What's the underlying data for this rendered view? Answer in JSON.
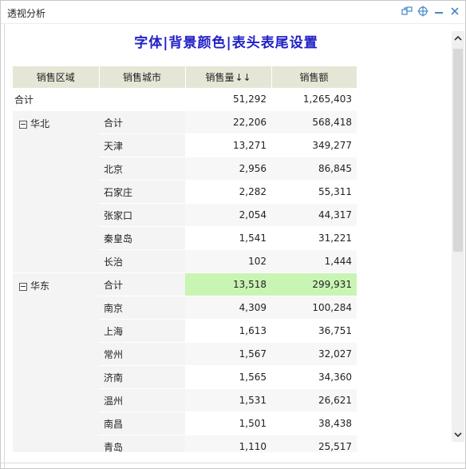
{
  "window": {
    "title": "透视分析"
  },
  "toolbar_icons": [
    "share-icon",
    "target-icon",
    "minimize-icon",
    "close-icon"
  ],
  "report": {
    "title_parts": [
      "字体",
      "背景颜色",
      "表头表尾设置"
    ],
    "separator": "|"
  },
  "table": {
    "headers": [
      "销售区域",
      "销售城市",
      "销售量",
      "销售额"
    ],
    "sort_indicator": "↓↓",
    "grand_total": {
      "label": "合计",
      "qty": "51,292",
      "amount": "1,265,403"
    },
    "groups": [
      {
        "region": "华北",
        "rows": [
          {
            "city": "合计",
            "qty": "22,206",
            "amount": "568,418"
          },
          {
            "city": "天津",
            "qty": "13,271",
            "amount": "349,277"
          },
          {
            "city": "北京",
            "qty": "2,956",
            "amount": "86,845"
          },
          {
            "city": "石家庄",
            "qty": "2,282",
            "amount": "55,311"
          },
          {
            "city": "张家口",
            "qty": "2,054",
            "amount": "44,317"
          },
          {
            "city": "秦皇岛",
            "qty": "1,541",
            "amount": "31,221"
          },
          {
            "city": "长治",
            "qty": "102",
            "amount": "1,444"
          }
        ]
      },
      {
        "region": "华东",
        "rows": [
          {
            "city": "合计",
            "qty": "13,518",
            "amount": "299,931",
            "highlight": true
          },
          {
            "city": "南京",
            "qty": "4,309",
            "amount": "100,284"
          },
          {
            "city": "上海",
            "qty": "1,613",
            "amount": "36,751"
          },
          {
            "city": "常州",
            "qty": "1,567",
            "amount": "32,027"
          },
          {
            "city": "济南",
            "qty": "1,565",
            "amount": "34,360"
          },
          {
            "city": "温州",
            "qty": "1,531",
            "amount": "26,621"
          },
          {
            "city": "南昌",
            "qty": "1,501",
            "amount": "38,438"
          },
          {
            "city": "青岛",
            "qty": "1,110",
            "amount": "25,517"
          }
        ]
      }
    ]
  },
  "colors": {
    "title_blue": "#2020c8",
    "header_bg": "#e6e6d6",
    "highlight_green": "#c8f5b4"
  }
}
